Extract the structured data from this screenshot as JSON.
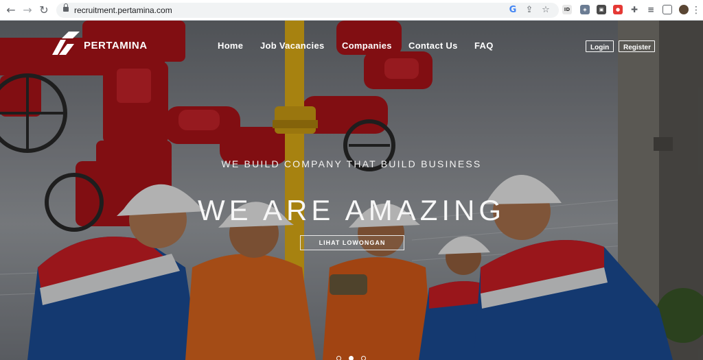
{
  "browser": {
    "url": "recruitment.pertamina.com",
    "back_glyph": "←",
    "forward_glyph": "→",
    "reload_glyph": "↻",
    "extensions": [
      "google-icon",
      "share-icon",
      "star-icon",
      "extension-icon",
      "media-icon",
      "sidebar-icon",
      "profile-avatar"
    ]
  },
  "site": {
    "brand": "PERTAMINA",
    "nav": {
      "home": "Home",
      "jobs": "Job Vacancies",
      "companies": "Companies",
      "contact": "Contact Us",
      "faq": "FAQ"
    },
    "login": "Login",
    "register": "Register"
  },
  "hero": {
    "tagline": "WE BUILD COMPANY THAT BUILD BUSINESS",
    "headline": "WE ARE AMAZING",
    "cta": "LIHAT LOWONGAN",
    "slides": 3,
    "active_slide": 2
  },
  "colors": {
    "brand_red": "#d51f26",
    "brand_blue": "#1d4f9c",
    "coverall_orange": "#e46a1f",
    "pipe_yellow": "#e8b417"
  }
}
